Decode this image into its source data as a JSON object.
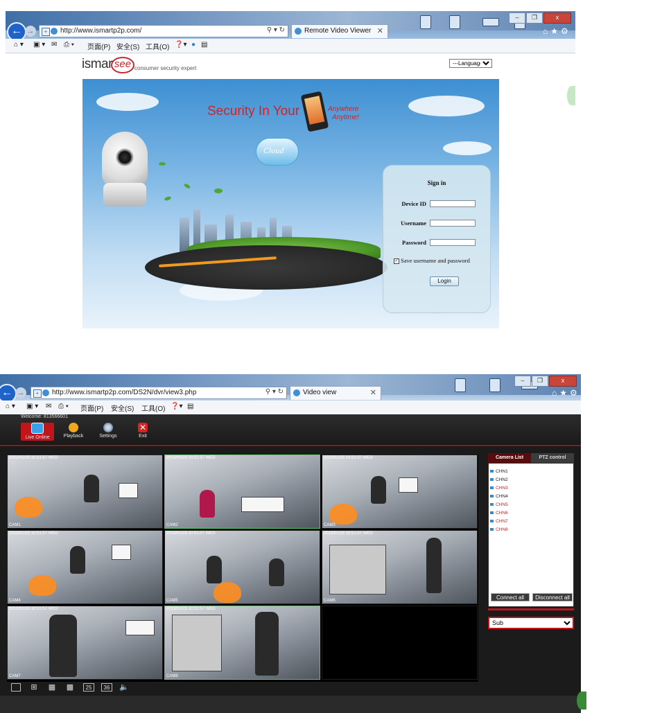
{
  "screen1": {
    "browser": {
      "url": "http://www.ismartp2p.com/",
      "tab_title": "Remote Video Viewer",
      "menu": [
        "页面(P)",
        "安全(S)",
        "工具(O)"
      ]
    },
    "logo": {
      "brand_left": "ismar",
      "brand_mark": "see",
      "tagline": "consumer security expert"
    },
    "language_select": {
      "value": "---Language---"
    },
    "hero": {
      "headline": "Security In Your",
      "sub1": "Anywhere",
      "sub2": "Anytime!",
      "cloud_badge": "Cloud"
    },
    "signin": {
      "title": "Sign in",
      "device_id_label": "Device ID",
      "username_label": "Username",
      "password_label": "Password",
      "save_label": "Save username and password",
      "save_checked": true,
      "login_button": "Login"
    }
  },
  "screen2": {
    "browser": {
      "url": "http://www.ismartp2p.com/DS2N/dvr/view3.php",
      "tab_title": "Video view",
      "menu": [
        "页面(P)",
        "安全(S)",
        "工具(O)"
      ]
    },
    "welcome": "Welcome: 813566601",
    "nav": [
      {
        "label": "Live Online",
        "icon": "monitor-icon",
        "active": true
      },
      {
        "label": "Playback",
        "icon": "play-icon",
        "active": false
      },
      {
        "label": "Settings",
        "icon": "gears-icon",
        "active": false
      },
      {
        "label": "Exit",
        "icon": "close-icon",
        "active": false
      }
    ],
    "channel_labels": [
      "CAM1",
      "CAM2",
      "CAM3",
      "CAM4",
      "CAM5",
      "CAM6",
      "CAM7",
      "CAM8"
    ],
    "osd_timestamp": "2013/01/25 10:51:57 WED",
    "layout_options": [
      "1",
      "4",
      "9",
      "16",
      "25",
      "36",
      "audio"
    ],
    "side_tabs": {
      "camera_list": "Camera List",
      "ptz_control": "PTZ control"
    },
    "cameras": [
      {
        "name": "CHN1",
        "color": "#1a1a1a"
      },
      {
        "name": "CHN2",
        "color": "#1a1a1a"
      },
      {
        "name": "CHN3",
        "color": "#d01f1f"
      },
      {
        "name": "CHN4",
        "color": "#1a1a1a"
      },
      {
        "name": "CHN5",
        "color": "#d01f1f"
      },
      {
        "name": "CHN6",
        "color": "#d01f1f"
      },
      {
        "name": "CHN7",
        "color": "#d01f1f"
      },
      {
        "name": "CHN8",
        "color": "#d01f1f"
      }
    ],
    "connect_all": "Connect all",
    "disconnect_all": "Disconnect all",
    "stream_select": "Sub"
  },
  "colors": {
    "accent_red": "#c2141b",
    "ie_blue": "#1d63c9",
    "selected_green": "#5cc86a"
  }
}
